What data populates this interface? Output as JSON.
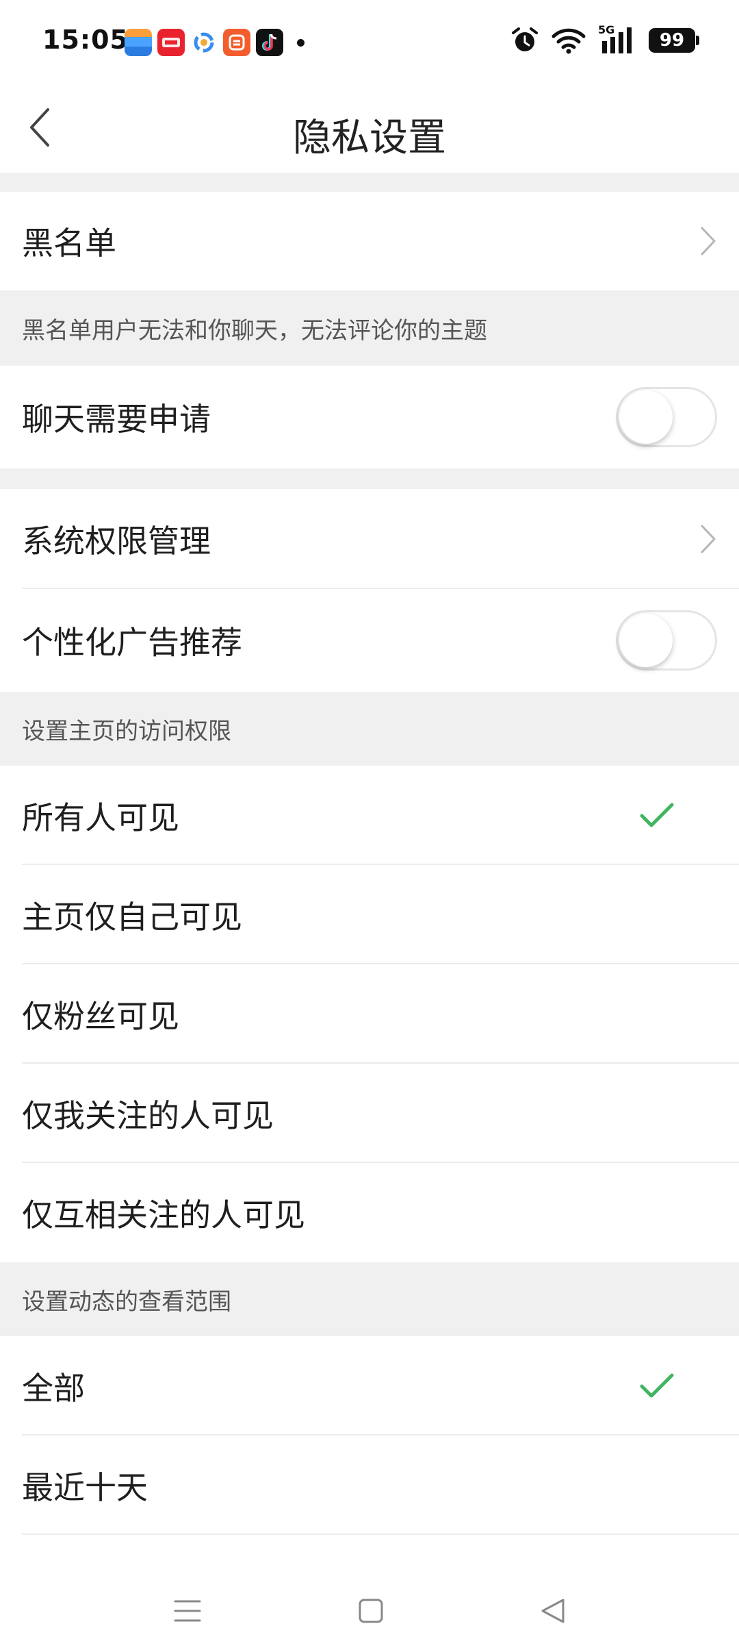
{
  "status_bar": {
    "time": "15:05",
    "battery": "99",
    "network": "5G",
    "notification_icons": [
      "wallet-icon",
      "jd-icon",
      "circle-app-icon",
      "pinduoduo-icon",
      "tiktok-icon"
    ]
  },
  "header": {
    "title": "隐私设置",
    "back_icon": "chevron-left-icon"
  },
  "blacklist": {
    "label": "黑名单",
    "description": "黑名单用户无法和你聊天，无法评论你的主题"
  },
  "chat_requires_request": {
    "label": "聊天需要申请",
    "enabled": false
  },
  "system_permissions": {
    "label": "系统权限管理"
  },
  "personalized_ads": {
    "label": "个性化广告推荐",
    "enabled": false
  },
  "homepage_access": {
    "header": "设置主页的访问权限",
    "options": [
      {
        "label": "所有人可见",
        "selected": true
      },
      {
        "label": "主页仅自己可见",
        "selected": false
      },
      {
        "label": "仅粉丝可见",
        "selected": false
      },
      {
        "label": "仅我关注的人可见",
        "selected": false
      },
      {
        "label": "仅互相关注的人可见",
        "selected": false
      }
    ]
  },
  "feed_range": {
    "header": "设置动态的查看范围",
    "options": [
      {
        "label": "全部",
        "selected": true
      },
      {
        "label": "最近十天",
        "selected": false
      }
    ]
  },
  "colors": {
    "check_green": "#3fb55f",
    "section_bg": "#f0f0f0",
    "divider": "#ececec"
  }
}
